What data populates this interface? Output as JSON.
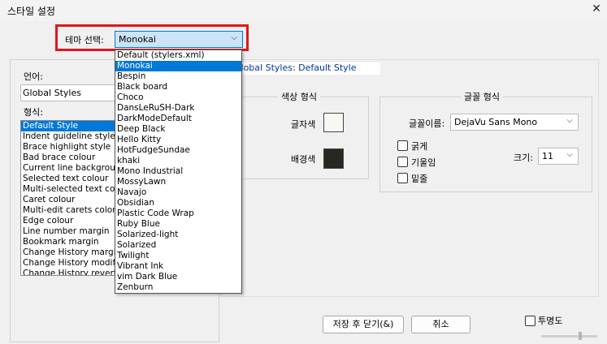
{
  "window": {
    "title": "스타일 설정",
    "close_glyph": "✕"
  },
  "theme": {
    "label": "테마 선택:",
    "selected": "Monokai",
    "options": [
      "Default (stylers.xml)",
      "Monokai",
      "Bespin",
      "Black board",
      "Choco",
      "DansLeRuSH-Dark",
      "DarkModeDefault",
      "Deep Black",
      "Hello Kitty",
      "HotFudgeSundae",
      "khaki",
      "Mono Industrial",
      "MossyLawn",
      "Navajo",
      "Obsidian",
      "Plastic Code Wrap",
      "Ruby Blue",
      "Solarized-light",
      "Solarized",
      "Twilight",
      "Vibrant Ink",
      "vim Dark Blue",
      "Zenburn"
    ],
    "selected_index": 1
  },
  "language": {
    "label": "언어:",
    "selected": "Global Styles"
  },
  "styles": {
    "label": "형식:",
    "items": [
      "Default Style",
      "Indent guideline style",
      "Brace highlight style",
      "Bad brace colour",
      "Current line background colour",
      "Selected text colour",
      "Multi-selected text colour",
      "Caret colour",
      "Multi-edit carets color",
      "Edge colour",
      "Line number margin",
      "Bookmark margin",
      "Change History margin",
      "Change History modified",
      "Change History reverted"
    ],
    "selected_index": 0
  },
  "style_title": "Global Styles: Default Style",
  "color_group": {
    "legend": "색상 형식",
    "fg_label": "글자색",
    "bg_label": "배경색",
    "fg_color": "#f8f8f2",
    "bg_color": "#272822"
  },
  "font_group": {
    "legend": "글꼴 형식",
    "name_label": "글꼴이름:",
    "name_value": "DejaVu Sans Mono",
    "bold_label": "굵게",
    "italic_label": "기울임",
    "underline_label": "밑줄",
    "size_label": "크기:",
    "size_value": "11"
  },
  "buttons": {
    "save_close": "저장 후 닫기(&)",
    "cancel": "취소",
    "transparency": "투명도"
  },
  "icons": {
    "chevron": "⌵"
  },
  "colors": {
    "accent": "#0078d7",
    "highlight_box": "#e0161b"
  }
}
